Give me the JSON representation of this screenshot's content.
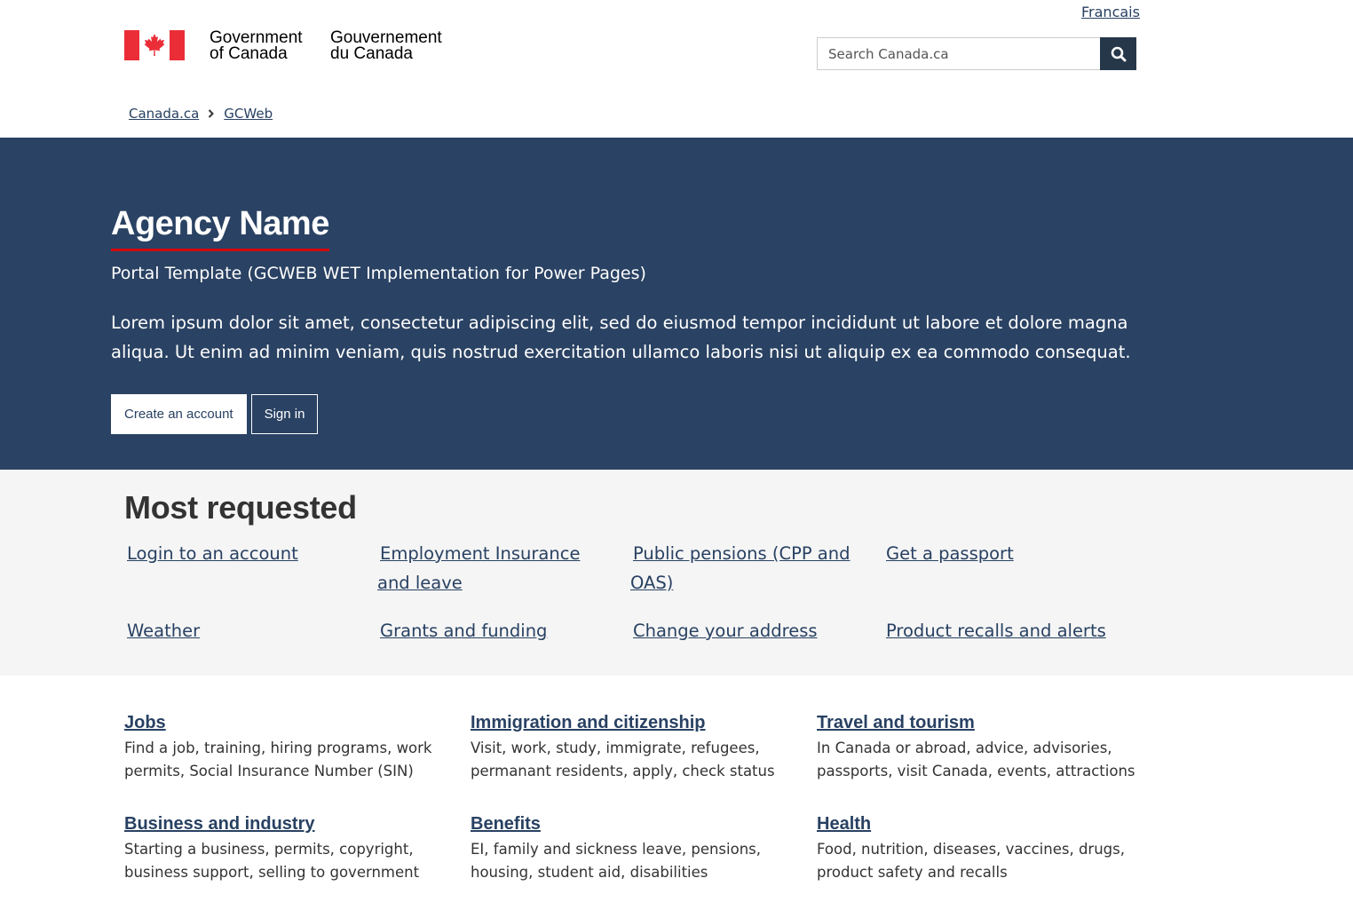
{
  "header": {
    "language_link": "Francais",
    "brand_en_line1": "Government",
    "brand_en_line2": "of Canada",
    "brand_fr_line1": "Gouvernement",
    "brand_fr_line2": "du Canada",
    "search_placeholder": "Search Canada.ca",
    "colors": {
      "flag_red": "#eb2d37",
      "search_button": "#26374a"
    }
  },
  "breadcrumb": {
    "items": [
      "Canada.ca",
      "GCWeb"
    ]
  },
  "hero": {
    "title": "Agency Name",
    "subtitle": "Portal Template (GCWEB WET Implementation for Power Pages)",
    "lead": "Lorem ipsum dolor sit amet, consectetur adipiscing elit, sed do eiusmod tempor incididunt ut labore et dolore magna aliqua. Ut enim ad minim veniam, quis nostrud exercitation ullamco laboris nisi ut aliquip ex ea commodo consequat.",
    "create_account": "Create an account",
    "sign_in": "Sign in",
    "colors": {
      "background": "#2a4263",
      "title_underline": "#d3080c"
    }
  },
  "most_requested": {
    "heading": "Most requested",
    "links": [
      "Login to an account",
      "Employment Insurance and leave",
      "Public pensions (CPP and OAS)",
      "Get a passport",
      "Weather",
      "Grants and funding",
      "Change your address",
      "Product recalls and alerts"
    ]
  },
  "services": [
    {
      "title": "Jobs",
      "desc": "Find a job, training, hiring programs, work permits, Social Insurance Number (SIN)"
    },
    {
      "title": "Immigration and citizenship",
      "desc": "Visit, work, study, immigrate, refugees, permanant residents, apply, check status"
    },
    {
      "title": "Travel and tourism",
      "desc": "In Canada or abroad, advice, advisories, passports, visit Canada, events, attractions"
    },
    {
      "title": "Business and industry",
      "desc": "Starting a business, permits, copyright, business support, selling to government"
    },
    {
      "title": "Benefits",
      "desc": "EI, family and sickness leave, pensions, housing, student aid, disabilities"
    },
    {
      "title": "Health",
      "desc": "Food, nutrition, diseases, vaccines, drugs, product safety and recalls"
    }
  ]
}
